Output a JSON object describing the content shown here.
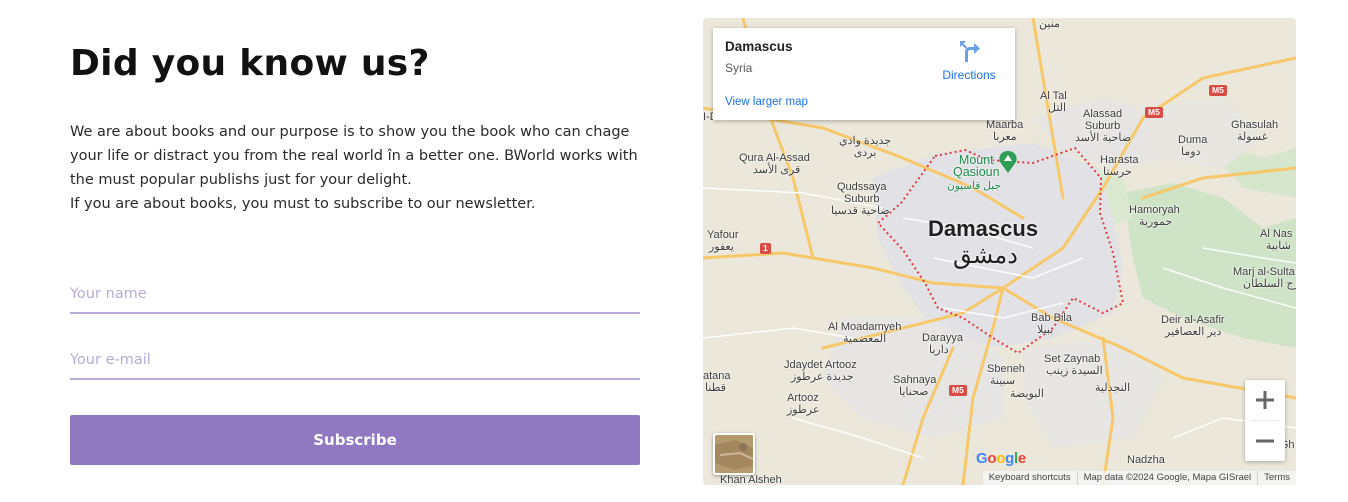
{
  "hero": {
    "title": "Did you know us?",
    "description_lines": [
      "We are about books and our purpose is to show you the book who can chage your life or distract you from the real world în a better one. BWorld works with the must popular publishs just for your delight.",
      "If you are about books, you must to subscribe to our newsletter."
    ]
  },
  "form": {
    "name_placeholder": "Your name",
    "email_placeholder": "Your e-mail",
    "subscribe_label": "Subscribe",
    "accent_color": "#9079c1",
    "underline_color": "#b9acd8"
  },
  "map": {
    "card": {
      "place": "Damascus",
      "region": "Syria",
      "directions_label": "Directions",
      "larger_map_label": "View larger map"
    },
    "city_name": "Damascus",
    "city_name_ar": "دمشق",
    "labels": {
      "mount_qasioun": "Mount\nQasioun",
      "mount_qasioun_ar": "جبل قاسيون",
      "al_tal": "Al Tal",
      "al_tal_ar": "التل",
      "alassad_suburb": "Alassad\nSuburb",
      "alassad_suburb_ar": "ضاحية الأسد",
      "duma": "Duma",
      "duma_ar": "دوما",
      "ghasulah": "Ghasulah",
      "ghasulah_ar": "غسولة",
      "maarba": "Maarba",
      "maarba_ar": "معربا",
      "harasta": "Harasta",
      "harasta_ar": "حرستا",
      "jdeidet_wadi": "جديدة وادي\nبردى",
      "qura_al_assad": "Qura Al-Assad",
      "qura_al_assad_ar": "قرى الأسد",
      "qudssaya_suburb": "Qudssaya\nSuburb",
      "qudssaya_suburb_ar": "ضاحية قدسيا",
      "hamoryah": "Hamoryah",
      "hamoryah_ar": "حمورية",
      "yafour": "Yafour",
      "yafour_ar": "يعفور",
      "al_nashabiyah": "Al Nas",
      "al_nashabiyah_ar": "شابية",
      "marj_al_sultan": "Marj al-Sulta",
      "marj_al_sultan_ar": "رج السلطان",
      "deir_al_asafir": "Deir al-Asafir",
      "deir_al_asafir_ar": "دير العصافير",
      "babbila": "Bab Bila",
      "babbila_ar": "ببيلا",
      "al_moadamyeh": "Al Moadamyeh",
      "al_moadamyeh_ar": "المعضمية",
      "darayya": "Darayya",
      "darayya_ar": "داريا",
      "set_zaynab": "Set Zaynab",
      "set_zaynab_ar": "السيدة زينب",
      "jdaydet_artooz": "Jdaydet Artooz",
      "jdaydet_artooz_ar": "جديدة عرطوز",
      "sbeneh": "Sbeneh",
      "sbeneh_ar": "سبينة",
      "sahnaya": "Sahnaya",
      "sahnaya_ar": "صحنايا",
      "al_bweida": "البويضة",
      "al_hajira": "النجدلية",
      "artooz": "Artooz",
      "artooz_ar": "عرطوز",
      "qatana": "atana",
      "qatana_ar": "قطنا",
      "al_ghizlaniyah": "Al Gh",
      "nadzha": "Nadzha",
      "khan_alsheh": "Khan Alsheh",
      "i_del": "I-Del",
      "i_del_ar": "دل",
      "mnin": "منين"
    },
    "shields": {
      "m5_top": "M5",
      "m5_right": "M5",
      "m5_bottom": "M5",
      "r1": "1"
    },
    "zoom_in": "+",
    "zoom_out": "−",
    "google": "Google",
    "attribution": [
      "Keyboard shortcuts",
      "Map data ©2024 Google, Mapa GISrael",
      "Terms"
    ]
  }
}
